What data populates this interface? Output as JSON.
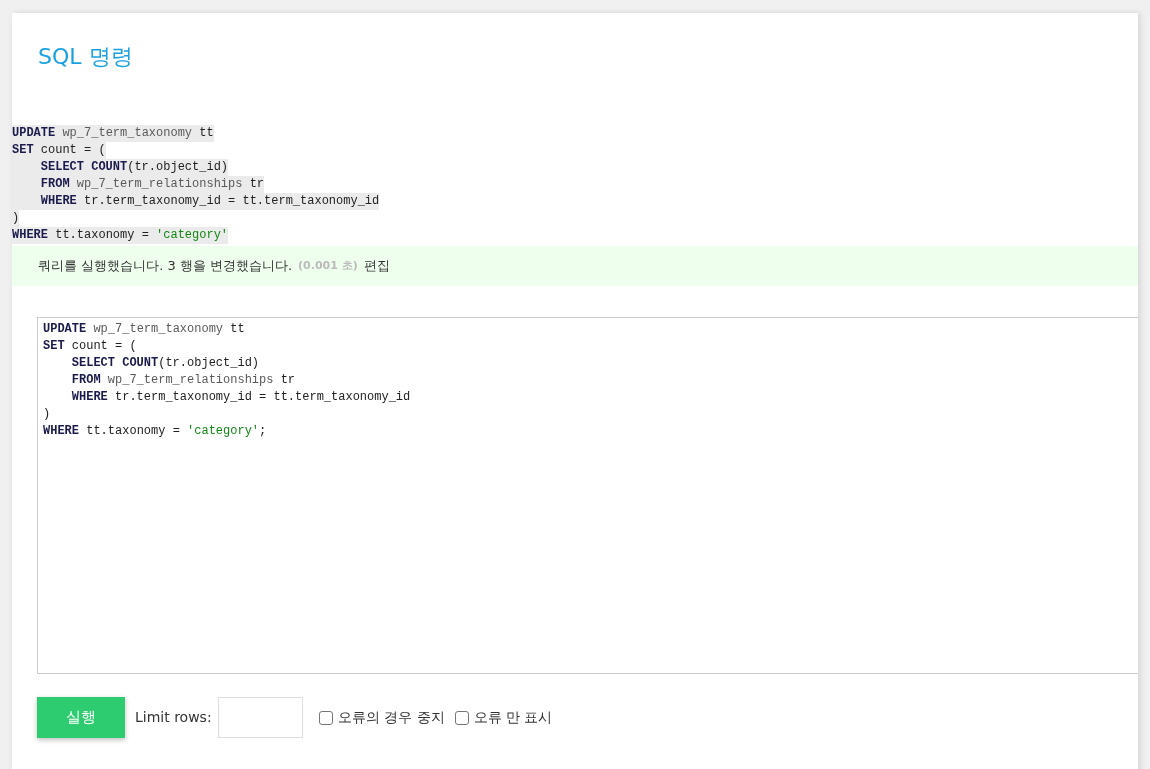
{
  "title": "SQL 명령",
  "executed_query": {
    "lines": [
      [
        {
          "kind": "keyword",
          "text": "UPDATE"
        },
        {
          "kind": "table",
          "text": " wp_7_term_taxonomy"
        },
        {
          "kind": "plain",
          "text": " tt"
        }
      ],
      [
        {
          "kind": "keyword",
          "text": "SET"
        },
        {
          "kind": "plain",
          "text": " count = ("
        }
      ],
      [
        {
          "kind": "keyword",
          "text": "    SELECT COUNT"
        },
        {
          "kind": "plain",
          "text": "(tr.object_id)"
        }
      ],
      [
        {
          "kind": "keyword",
          "text": "    FROM"
        },
        {
          "kind": "table",
          "text": " wp_7_term_relationships"
        },
        {
          "kind": "plain",
          "text": " tr"
        }
      ],
      [
        {
          "kind": "keyword",
          "text": "    WHERE"
        },
        {
          "kind": "plain",
          "text": " tr.term_taxonomy_id = tt.term_taxonomy_id"
        }
      ],
      [
        {
          "kind": "plain",
          "text": ")"
        }
      ],
      [
        {
          "kind": "keyword",
          "text": "WHERE"
        },
        {
          "kind": "plain",
          "text": " tt.taxonomy = "
        },
        {
          "kind": "string",
          "text": "'category'"
        }
      ]
    ]
  },
  "message": {
    "text": "쿼리를 실행했습니다. 3 행을 변경했습니다.",
    "time": "(0.001 초)",
    "edit_link": "편집"
  },
  "editor": {
    "lines": [
      [
        {
          "kind": "keyword",
          "text": "UPDATE"
        },
        {
          "kind": "table",
          "text": " wp_7_term_taxonomy"
        },
        {
          "kind": "plain",
          "text": " tt"
        }
      ],
      [
        {
          "kind": "keyword",
          "text": "SET"
        },
        {
          "kind": "plain",
          "text": " count = ("
        }
      ],
      [
        {
          "kind": "keyword",
          "text": "    SELECT COUNT"
        },
        {
          "kind": "plain",
          "text": "(tr.object_id)"
        }
      ],
      [
        {
          "kind": "keyword",
          "text": "    FROM"
        },
        {
          "kind": "table",
          "text": " wp_7_term_relationships"
        },
        {
          "kind": "plain",
          "text": " tr"
        }
      ],
      [
        {
          "kind": "keyword",
          "text": "    WHERE"
        },
        {
          "kind": "plain",
          "text": " tr.term_taxonomy_id = tt.term_taxonomy_id"
        }
      ],
      [
        {
          "kind": "plain",
          "text": ")"
        }
      ],
      [
        {
          "kind": "keyword",
          "text": "WHERE"
        },
        {
          "kind": "plain",
          "text": " tt.taxonomy = "
        },
        {
          "kind": "string",
          "text": "'category'"
        },
        {
          "kind": "plain",
          "text": ";"
        }
      ]
    ]
  },
  "controls": {
    "execute_button": "실행",
    "limit_rows_label": "Limit rows:",
    "checkboxes": [
      {
        "label": "오류의 경우 중지",
        "checked": false
      },
      {
        "label": "오류 만 표시",
        "checked": false
      }
    ]
  }
}
